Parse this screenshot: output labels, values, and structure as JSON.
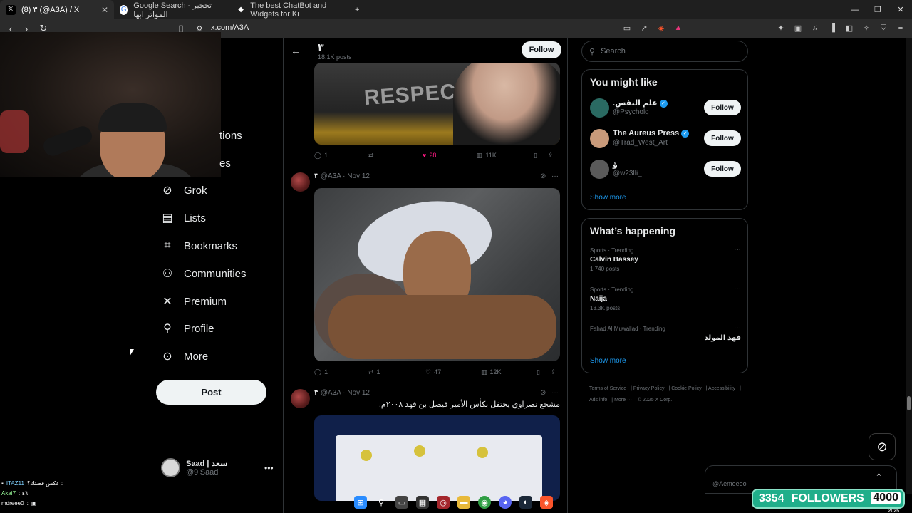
{
  "browser": {
    "tabs": [
      {
        "label": "(8) ٣ (@A3A) / X",
        "favicon": "x-logo",
        "active": true
      },
      {
        "label": "Google Search - تحجير المواتر ابها",
        "favicon": "google-logo",
        "active": false
      },
      {
        "label": "The best ChatBot and Widgets for Ki",
        "favicon": "chatbot-logo",
        "active": false
      }
    ],
    "url": "x.com/A3A"
  },
  "left_nav": {
    "partial_items": [
      "tions",
      "es"
    ],
    "items": [
      {
        "label": "Grok",
        "icon": "grok-icon"
      },
      {
        "label": "Lists",
        "icon": "lists-icon"
      },
      {
        "label": "Bookmarks",
        "icon": "bookmark-icon"
      },
      {
        "label": "Communities",
        "icon": "communities-icon"
      },
      {
        "label": "Premium",
        "icon": "x-logo-icon"
      },
      {
        "label": "Profile",
        "icon": "profile-icon"
      },
      {
        "label": "More",
        "icon": "more-icon"
      }
    ],
    "post_label": "Post",
    "account": {
      "name": "Saad | سعد",
      "handle": "@9lSaad"
    }
  },
  "profile_header": {
    "name": "٣",
    "posts": "18.1K posts",
    "follow_label": "Follow"
  },
  "feed": {
    "post1": {
      "media_text": "RESPECT",
      "stats": {
        "replies": "1",
        "likes": "28",
        "views": "11K"
      }
    },
    "post2": {
      "author": "٣",
      "handle": "@A3A",
      "date": "Nov 12",
      "stats": {
        "replies": "1",
        "reposts": "1",
        "likes": "47",
        "views": "12K"
      }
    },
    "post3": {
      "author": "٣",
      "handle": "@A3A",
      "date": "Nov 12",
      "text": "مشجع نصراوي يحتفل بكأس الأمير فيصل بن فهد ٢٠٠٨م."
    }
  },
  "right": {
    "search_placeholder": "Search",
    "you_might_like": {
      "title": "You might like",
      "items": [
        {
          "name": ".علم النفس",
          "handle": "@Psycholg",
          "verified": true,
          "follow": "Follow"
        },
        {
          "name": "The Aureus Press",
          "handle": "@Trad_West_Art",
          "verified": true,
          "follow": "Follow"
        },
        {
          "name": "ؤ",
          "handle": "@w23lli_",
          "verified": false,
          "follow": "Follow"
        }
      ],
      "show_more": "Show more"
    },
    "whats_happening": {
      "title": "What’s happening",
      "trends": [
        {
          "category": "Sports · Trending",
          "title": "Calvin Bassey",
          "count": "1,740 posts"
        },
        {
          "category": "Sports · Trending",
          "title": "Naija",
          "count": "13.3K posts"
        },
        {
          "category": "Fahad Al Muwallad · Trending",
          "title": "فهد المولد",
          "count": ""
        }
      ],
      "show_more": "Show more"
    },
    "footer": [
      "Terms of Service",
      "Privacy Policy",
      "Cookie Policy",
      "Accessibility",
      "Ads info",
      "More ···",
      "© 2025 X Corp."
    ]
  },
  "overlay": {
    "messages_user": "@Aemeeeo",
    "followers_current": "3354",
    "followers_label": "FOLLOWERS",
    "followers_goal": "4000",
    "followers_year": "2025",
    "chat": [
      {
        "user": "ITAZ11",
        "text": "عكس قصتك؟ :"
      },
      {
        "user": "Akai7",
        "text": ": ٤٦"
      },
      {
        "user": "mdreee0",
        "text": ":"
      }
    ]
  }
}
